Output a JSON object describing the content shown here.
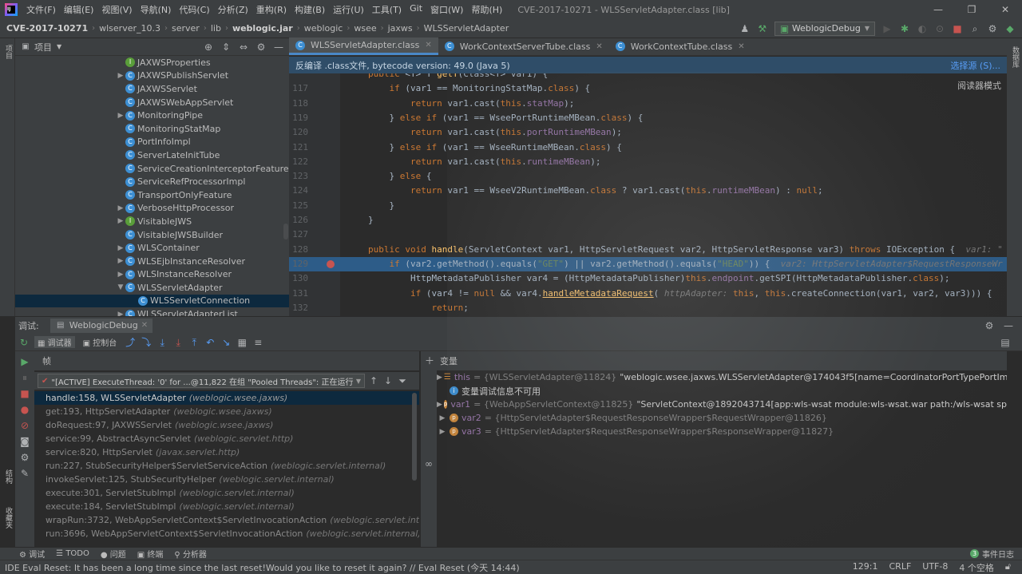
{
  "menubar": {
    "items": [
      "文件(F)",
      "编辑(E)",
      "视图(V)",
      "导航(N)",
      "代码(C)",
      "分析(Z)",
      "重构(R)",
      "构建(B)",
      "运行(U)",
      "工具(T)",
      "Git",
      "窗口(W)",
      "帮助(H)"
    ],
    "window_title": "CVE-2017-10271 - WLSServletAdapter.class [lib]"
  },
  "breadcrumb": [
    "CVE-2017-10271",
    "wlserver_10.3",
    "server",
    "lib",
    "weblogic.jar",
    "weblogic",
    "wsee",
    "jaxws",
    "WLSServletAdapter"
  ],
  "run_config": "WeblogicDebug",
  "project": {
    "header": "项目",
    "tree": [
      {
        "label": "JAXWSProperties",
        "arrow": "",
        "icon": "I"
      },
      {
        "label": "JAXWSPublishServlet",
        "arrow": "▶",
        "icon": "C"
      },
      {
        "label": "JAXWSServlet",
        "arrow": "",
        "icon": "C"
      },
      {
        "label": "JAXWSWebAppServlet",
        "arrow": "",
        "icon": "C"
      },
      {
        "label": "MonitoringPipe",
        "arrow": "▶",
        "icon": "C"
      },
      {
        "label": "MonitoringStatMap",
        "arrow": "",
        "icon": "C"
      },
      {
        "label": "PortInfoImpl",
        "arrow": "",
        "icon": "C"
      },
      {
        "label": "ServerLateInitTube",
        "arrow": "",
        "icon": "C"
      },
      {
        "label": "ServiceCreationInterceptorFeature",
        "arrow": "",
        "icon": "C"
      },
      {
        "label": "ServiceRefProcessorImpl",
        "arrow": "",
        "icon": "C"
      },
      {
        "label": "TransportOnlyFeature",
        "arrow": "",
        "icon": "C"
      },
      {
        "label": "VerboseHttpProcessor",
        "arrow": "▶",
        "icon": "C"
      },
      {
        "label": "VisitableJWS",
        "arrow": "▶",
        "icon": "I"
      },
      {
        "label": "VisitableJWSBuilder",
        "arrow": "",
        "icon": "C"
      },
      {
        "label": "WLSContainer",
        "arrow": "▶",
        "icon": "C"
      },
      {
        "label": "WLSEjbInstanceResolver",
        "arrow": "▶",
        "icon": "C"
      },
      {
        "label": "WLSInstanceResolver",
        "arrow": "▶",
        "icon": "C"
      },
      {
        "label": "WLSServletAdapter",
        "arrow": "▼",
        "icon": "C"
      },
      {
        "label": "WLSServletConnection",
        "arrow": "",
        "icon": "C",
        "selected": true,
        "indent": true
      },
      {
        "label": "WLSServletAdapterList",
        "arrow": "▶",
        "icon": "C"
      }
    ]
  },
  "tabs": [
    {
      "label": "WLSServletAdapter.class",
      "active": true
    },
    {
      "label": "WorkContextServerTube.class",
      "active": false
    },
    {
      "label": "WorkContextTube.class",
      "active": false
    }
  ],
  "decompile_bar": {
    "message": "反编译 .class文件, bytecode version: 49.0 (Java 5)",
    "link": "选择源 (S)...",
    "reader_mode": "阅读器模式"
  },
  "code_lines": [
    {
      "n": "",
      "html": "<span class='kw'>public</span> &lt;T&gt; T <span class='fn'>getT</span>(Class&lt;T&gt; var1) {"
    },
    {
      "n": "117",
      "html": "    <span class='kw'>if</span> (var1 == MonitoringStatMap.<span class='kw'>class</span>) {"
    },
    {
      "n": "118",
      "html": "        <span class='kw'>return</span> var1.cast(<span class='kw'>this</span>.<span class='fld'>statMap</span>);"
    },
    {
      "n": "119",
      "html": "    } <span class='kw'>else if</span> (var1 == WseePortRuntimeMBean.<span class='kw'>class</span>) {"
    },
    {
      "n": "120",
      "html": "        <span class='kw'>return</span> var1.cast(<span class='kw'>this</span>.<span class='fld'>portRuntimeMBean</span>);"
    },
    {
      "n": "121",
      "html": "    } <span class='kw'>else if</span> (var1 == WseeRuntimeMBean.<span class='kw'>class</span>) {"
    },
    {
      "n": "122",
      "html": "        <span class='kw'>return</span> var1.cast(<span class='kw'>this</span>.<span class='fld'>runtimeMBean</span>);"
    },
    {
      "n": "123",
      "html": "    } <span class='kw'>else</span> {"
    },
    {
      "n": "124",
      "html": "        <span class='kw'>return</span> var1 == WseeV2RuntimeMBean.<span class='kw'>class</span> ? var1.cast(<span class='kw'>this</span>.<span class='fld'>runtimeMBean</span>) : <span class='kw'>null</span>;"
    },
    {
      "n": "125",
      "html": "    }"
    },
    {
      "n": "126",
      "html": "}"
    },
    {
      "n": "127",
      "html": ""
    },
    {
      "n": "128",
      "html": "<span class='kw'>public void</span> <span class='fn'>handle</span>(ServletContext var1, HttpServletRequest var2, HttpServletResponse var3) <span class='kw'>throws</span> IOException {  <span class='hint'>var1: \"</span>"
    },
    {
      "n": "129",
      "html": "    <span class='kw'>if</span> (var2.getMethod().equals(<span class='str'>\"GET\"</span>) || var2.getMethod().equals(<span class='str'>\"HEAD\"</span>)) {  <span class='hint'>var2: HttpServletAdapter$RequestResponseWr</span>",
      "highlight": true,
      "breakpoint": true
    },
    {
      "n": "130",
      "html": "        HttpMetadataPublisher var4 = (HttpMetadataPublisher)<span class='kw'>this</span>.<span class='fld'>endpoint</span>.getSPI(HttpMetadataPublisher.<span class='kw'>class</span>);"
    },
    {
      "n": "131",
      "html": "        <span class='kw'>if</span> (var4 != <span class='kw'>null</span> &amp;&amp; var4.<span class='fn' style='text-decoration:underline'>handleMetadataRequest</span>( <span class='hint'>httpAdapter:</span> <span class='kw'>this</span>, <span class='kw'>this</span>.createConnection(var1, var2, var3))) {"
    },
    {
      "n": "132",
      "html": "            <span class='kw'>return</span>;"
    }
  ],
  "debug": {
    "label": "调试:",
    "session": "WeblogicDebug",
    "tabs": [
      "调试器",
      "控制台"
    ],
    "frames_header": "帧",
    "thread": "\"[ACTIVE] ExecuteThread: '0' for ...@11,822 在组 \"Pooled Threads\": 正在运行",
    "frames": [
      {
        "method": "handle:158, WLSServletAdapter",
        "pkg": "(weblogic.wsee.jaxws)",
        "selected": true
      },
      {
        "method": "get:193, HttpServletAdapter",
        "pkg": "(weblogic.wsee.jaxws)"
      },
      {
        "method": "doRequest:97, JAXWSServlet",
        "pkg": "(weblogic.wsee.jaxws)"
      },
      {
        "method": "service:99, AbstractAsyncServlet",
        "pkg": "(weblogic.servlet.http)"
      },
      {
        "method": "service:820, HttpServlet",
        "pkg": "(javax.servlet.http)"
      },
      {
        "method": "run:227, StubSecurityHelper$ServletServiceAction",
        "pkg": "(weblogic.servlet.internal)"
      },
      {
        "method": "invokeServlet:125, StubSecurityHelper",
        "pkg": "(weblogic.servlet.internal)"
      },
      {
        "method": "execute:301, ServletStubImpl",
        "pkg": "(weblogic.servlet.internal)"
      },
      {
        "method": "execute:184, ServletStubImpl",
        "pkg": "(weblogic.servlet.internal)"
      },
      {
        "method": "wrapRun:3732, WebAppServletContext$ServletInvocationAction",
        "pkg": "(weblogic.servlet.internal)"
      },
      {
        "method": "run:3696, WebAppServletContext$ServletInvocationAction",
        "pkg": "(weblogic.servlet.internal)"
      }
    ],
    "vars_header": "变量",
    "vars": [
      {
        "name": "this",
        "type": "= {WLSServletAdapter@11824}",
        "value": "\"weblogic.wsee.jaxws.WLSServletAdapter@174043f5[name=CoordinatorPortTypePortImpl]\"",
        "kind": "eq"
      },
      {
        "name": "",
        "type": "",
        "value": "变量调试信息不可用",
        "kind": "info"
      },
      {
        "name": "var1",
        "type": "= {WebAppServletContext@11825}",
        "value": "\"ServletContext@1892043714[app:wls-wsat module:wls-wsat.war path:/wls-wsat spec-version:2.5]\"",
        "kind": "p"
      },
      {
        "name": "var2",
        "type": "= {HttpServletAdapter$RequestResponseWrapper$RequestWrapper@11826}",
        "value": "",
        "kind": "p"
      },
      {
        "name": "var3",
        "type": "= {HttpServletAdapter$RequestResponseWrapper$ResponseWrapper@11827}",
        "value": "",
        "kind": "p"
      }
    ]
  },
  "bottom_tools": {
    "items": [
      "调试",
      "TODO",
      "问题",
      "终端",
      "分析器"
    ],
    "event_log": "事件日志",
    "event_count": "3"
  },
  "status": {
    "message": "IDE Eval Reset: It has been a long time since the last reset!Would you like to reset it again? // Eval Reset (今天 14:44)",
    "position": "129:1",
    "line_sep": "CRLF",
    "encoding": "UTF-8",
    "indent": "4 个空格"
  },
  "left_strip_labels": [
    "项目",
    "结构",
    "收藏夹"
  ],
  "right_strip_label": "数据库"
}
